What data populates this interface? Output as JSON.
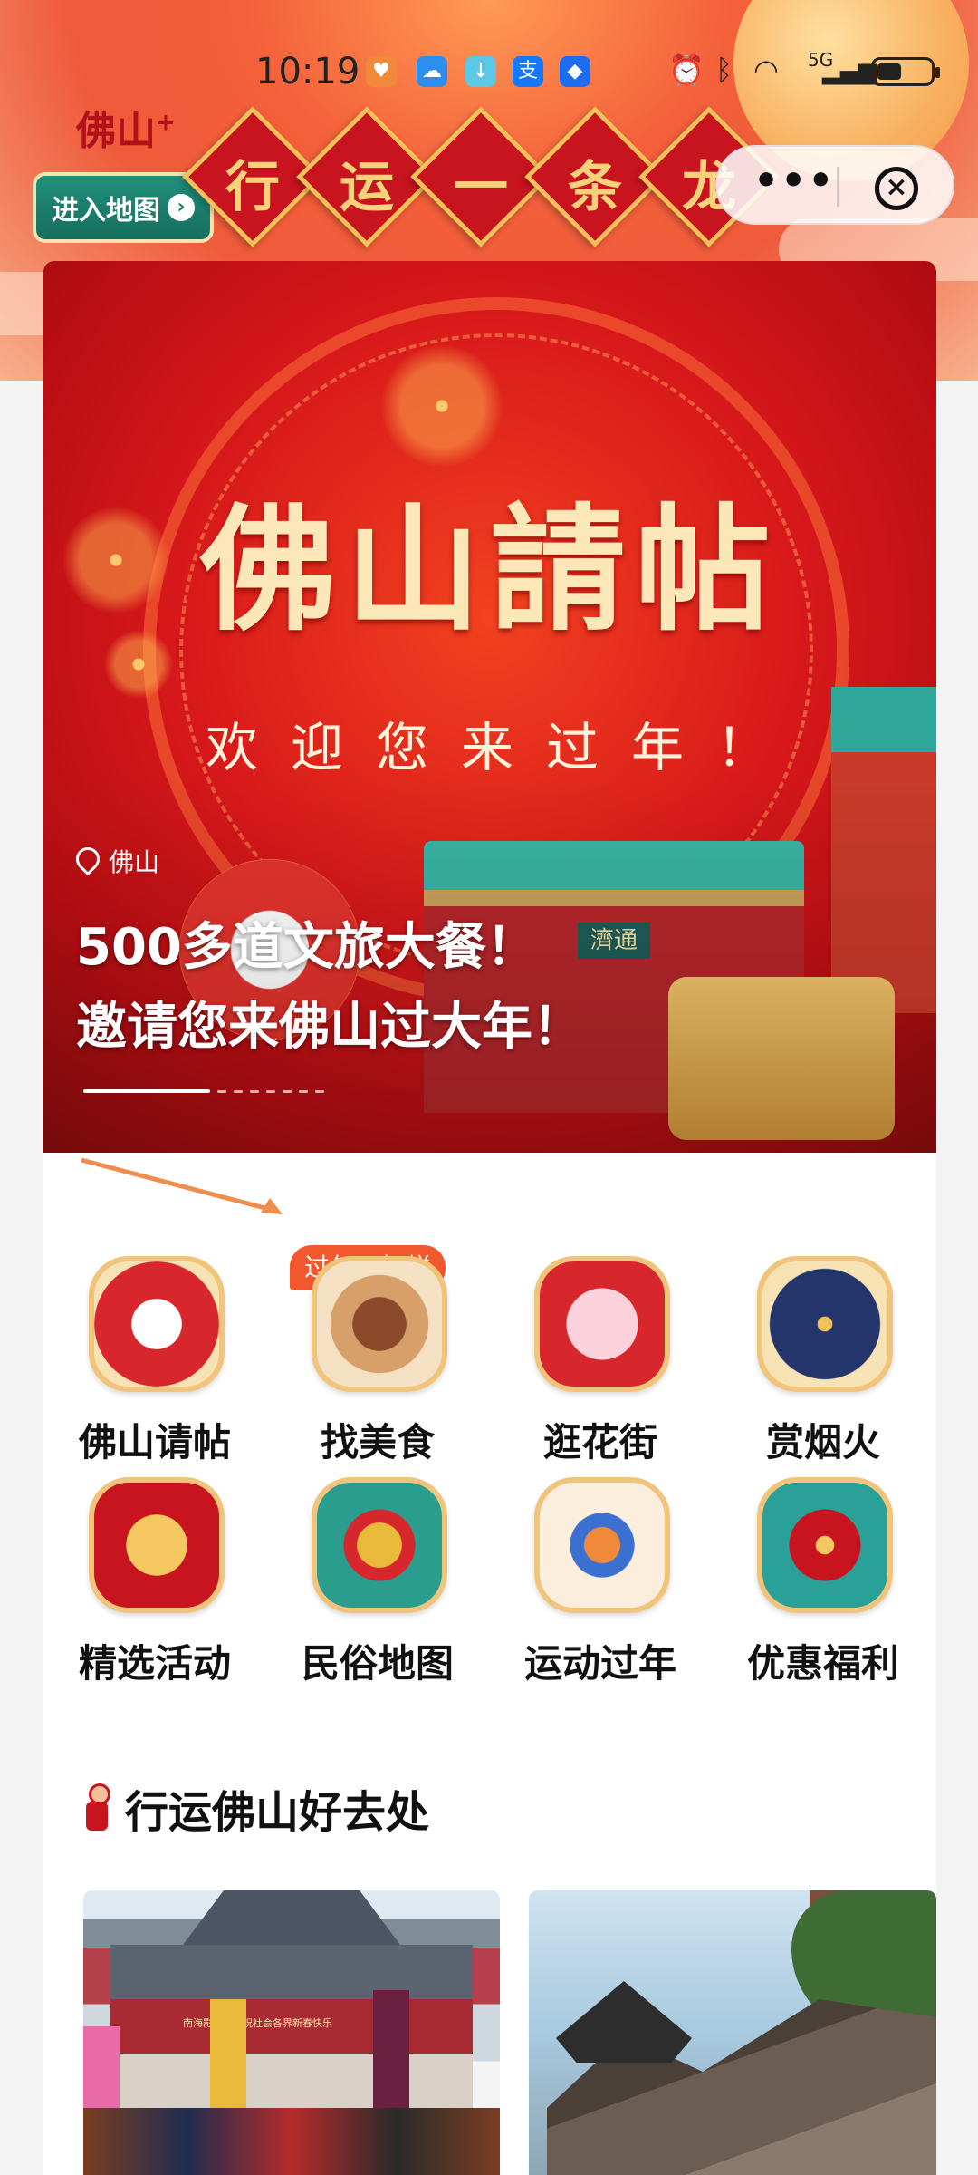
{
  "status_bar": {
    "time": "10:19",
    "network": "5G"
  },
  "header": {
    "brand": "佛山",
    "brand_plus": "+",
    "map_button": "进入地图",
    "map_button_icon": "chevron-right-icon",
    "slogan": [
      "行",
      "运",
      "一",
      "条",
      "龙"
    ],
    "more_icon": "more-dots-icon",
    "close_icon": "close-circle-icon"
  },
  "banner": {
    "title": "佛山請帖",
    "subtitle": "欢迎您来过年！",
    "gate_sign": "濟通",
    "location": "佛山",
    "headline_1": "500多道文旅大餐！",
    "headline_2": "邀请您来佛山过大年！"
  },
  "grid": {
    "tag": "过年不打烊",
    "items": [
      {
        "label": "佛山请帖",
        "icon": "lion-dance-icon"
      },
      {
        "label": "找美食",
        "icon": "food-platter-icon"
      },
      {
        "label": "逛花街",
        "icon": "flower-icon"
      },
      {
        "label": "赏烟火",
        "icon": "fireworks-icon"
      },
      {
        "label": "精选活动",
        "icon": "gong-icon"
      },
      {
        "label": "民俗地图",
        "icon": "dragon-icon"
      },
      {
        "label": "运动过年",
        "icon": "skateboard-icon"
      },
      {
        "label": "优惠福利",
        "icon": "lucky-bag-icon"
      }
    ]
  },
  "section": {
    "title": "行运佛山好去处",
    "cards": [
      {
        "caption": "南海影视城恭祝社会各界新春快乐"
      },
      {
        "caption": ""
      }
    ]
  },
  "colors": {
    "primary_red": "#c8141f",
    "gold": "#f1c47c",
    "teal": "#1a7a68",
    "tag_orange": "#f2572d"
  }
}
